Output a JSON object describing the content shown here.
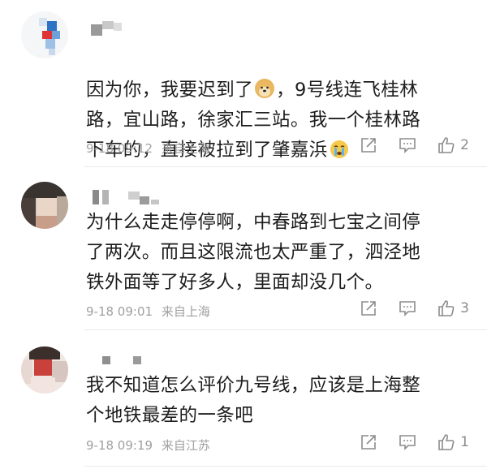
{
  "comments": [
    {
      "text_line1": "因为你，我要迟到了",
      "text_line1b": "，9号线连飞桂林",
      "text_line2": "路，宜山路，徐家汇三站。我一个桂林路",
      "text_line3": "下车的，直接被拉到了肇嘉浜",
      "date": "9-18 09:12",
      "location": "来自上海",
      "likes": "2"
    },
    {
      "text": "为什么走走停停啊，中春路到七宝之间停\n了两次。而且这限流也太严重了，泗泾地\n铁外面等了好多人，里面却没几个。",
      "date": "9-18 09:01",
      "location": "来自上海",
      "likes": "3"
    },
    {
      "text": "我不知道怎么评价九号线，应该是上海整\n个地铁最差的一条吧",
      "date": "9-18 09:19",
      "location": "来自江苏",
      "likes": "1"
    }
  ],
  "icons": {
    "forward": "forward-icon",
    "comment": "comment-icon",
    "like": "thumbs-up-icon",
    "dog": "doge-emoji-icon",
    "cry": "crying-emoji-icon"
  }
}
